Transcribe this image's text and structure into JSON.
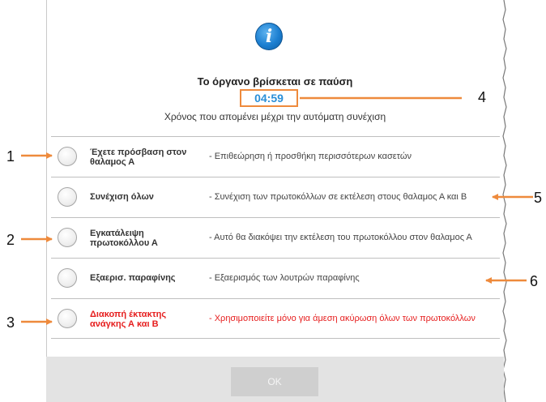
{
  "dialog": {
    "title": "Το όργανο βρίσκεται σε παύση",
    "countdown": "04:59",
    "subtitle": "Χρόνος που απομένει μέχρι την αυτόματη συνέχιση",
    "options": [
      {
        "label": "Έχετε πρόσβαση στον θαλαμος Α",
        "description": "- Επιθεώρηση ή προσθήκη περισσότερων κασετών"
      },
      {
        "label": "Συνέχιση όλων",
        "description": "- Συνέχιση των πρωτοκόλλων σε εκτέλεση στους θαλαμος Α και Β"
      },
      {
        "label": "Εγκατάλειψη πρωτοκόλλου Α",
        "description": "- Αυτό θα διακόψει την εκτέλεση του πρωτοκόλλου στον θαλαμος Α"
      },
      {
        "label": "Εξαερισ. παραφίνης",
        "description": "- Εξαερισμός των λουτρών παραφίνης"
      },
      {
        "label": "Διακοπή έκτακτης ανάγκης Α και Β",
        "description": "- Χρησιμοποιείτε μόνο για άμεση ακύρωση όλων των πρωτοκόλλων"
      }
    ],
    "ok_label": "OK"
  },
  "callouts": [
    "1",
    "2",
    "3",
    "4",
    "5",
    "6"
  ],
  "colors": {
    "callout_orange": "#ee8a3c",
    "timer_blue": "#2a8fd8",
    "danger_red": "#e61e1e",
    "info_blue": "#1c7fd1"
  },
  "icons": {
    "info": "info-icon"
  }
}
